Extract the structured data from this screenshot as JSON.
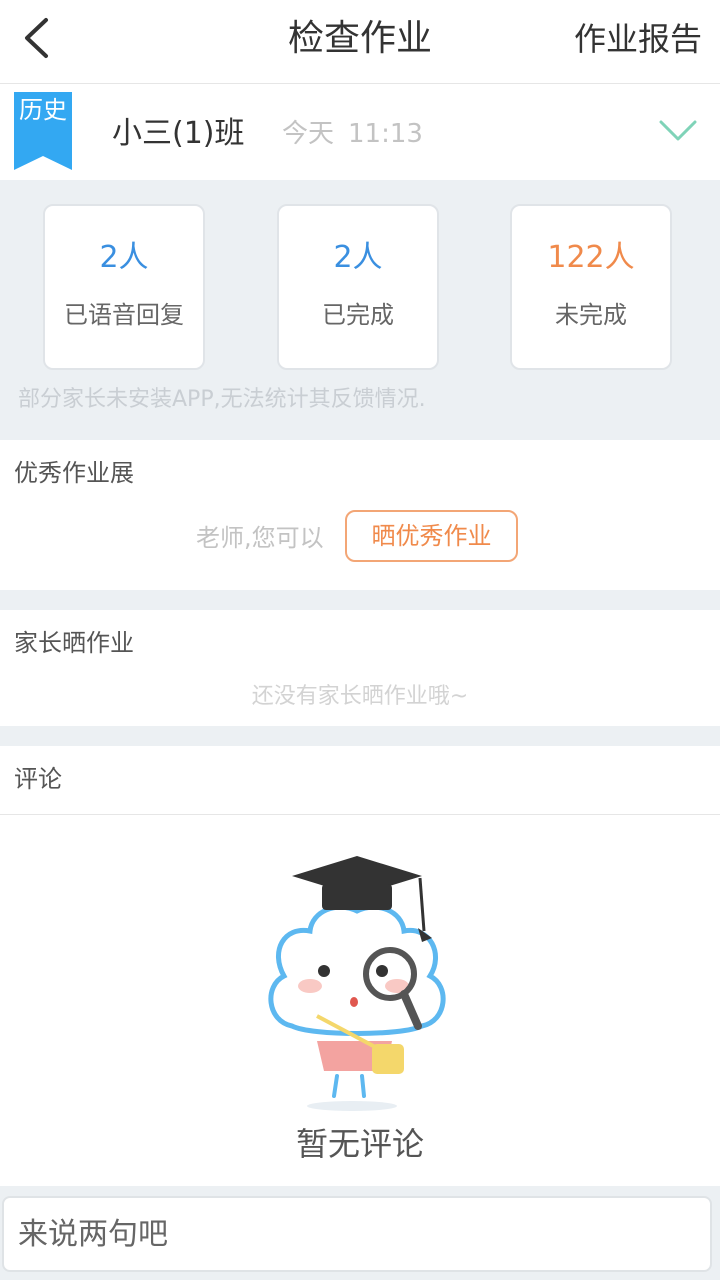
{
  "header": {
    "title": "检查作业",
    "report_label": "作业报告"
  },
  "class_info": {
    "history_tag": "历史",
    "class_name": "小三(1)班",
    "day": "今天",
    "time": "11:13"
  },
  "stats": {
    "cards": [
      {
        "value": "2人",
        "label": "已语音回复"
      },
      {
        "value": "2人",
        "label": "已完成"
      },
      {
        "value": "122人",
        "label": "未完成"
      }
    ],
    "note": "部分家长未安装APP,无法统计其反馈情况."
  },
  "showcase": {
    "title": "优秀作业展",
    "prompt": "老师,您可以",
    "button_label": "晒优秀作业"
  },
  "parent_share": {
    "title": "家长晒作业",
    "empty_text": "还没有家长晒作业哦~"
  },
  "comments": {
    "title": "评论",
    "empty_text": "暂无评论"
  },
  "comment_input": {
    "placeholder": "来说两句吧"
  },
  "colors": {
    "accent_blue": "#33a8f2",
    "value_blue": "#3a8fe0",
    "accent_orange": "#f08a4b",
    "chevron_green": "#7fd3b8"
  },
  "icons": {
    "back": "back-arrow-icon",
    "expand": "chevron-down-icon",
    "mascot": "cloud-mascot-graduate-magnifier"
  }
}
